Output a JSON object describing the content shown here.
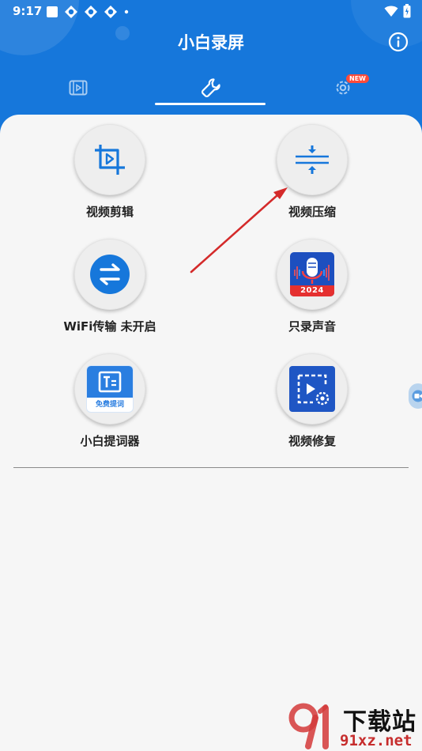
{
  "status_bar": {
    "time": "9:17"
  },
  "app": {
    "title": "小白录屏"
  },
  "tabs": [
    {
      "icon": "film-icon"
    },
    {
      "icon": "wrench-icon"
    },
    {
      "icon": "settings-gear-icon",
      "badge": "NEW"
    }
  ],
  "tools": [
    {
      "label": "视频剪辑",
      "icon": "crop-icon"
    },
    {
      "label": "视频压缩",
      "icon": "compress-icon"
    },
    {
      "label": "WiFi传输 未开启",
      "icon": "transfer-arrows-icon"
    },
    {
      "label": "只录声音",
      "icon": "microphone-icon",
      "icon_text": "2024"
    },
    {
      "label": "小白提词器",
      "icon": "teleprompter-icon",
      "icon_text": "免费提词"
    },
    {
      "label": "视频修复",
      "icon": "video-repair-icon"
    }
  ],
  "watermark": {
    "brand": "下载站",
    "site": "91xz.net"
  },
  "colors": {
    "primary": "#1677db",
    "badge": "#ff4b3a",
    "arrow": "#d42a2a"
  }
}
